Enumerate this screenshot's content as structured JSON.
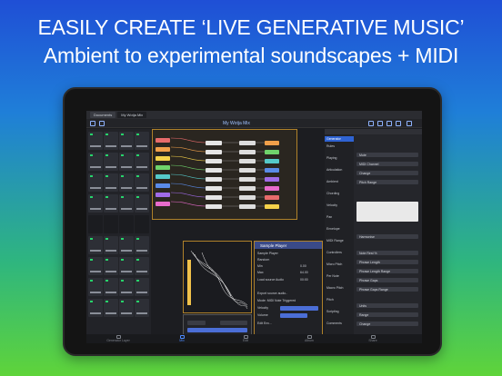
{
  "headline": {
    "line1": "EASILY CREATE ‘LIVE GENERATIVE MUSIC’",
    "line2": "Ambient to experimental soundscapes + MIDI"
  },
  "app": {
    "tabs": [
      "Documents",
      "My Wotja Mix"
    ],
    "title": "My Wotja Mix",
    "bottom_tabs": [
      "Generator Layer",
      "Mix",
      "Edit",
      "Album",
      "Share"
    ],
    "active_tab_index": 1
  },
  "properties_panel": {
    "side_items": [
      "Generator",
      "Rules",
      "Playing",
      "Articulation",
      "Ambient",
      "Chording",
      "Velocity",
      "Pan",
      "Envelope",
      "MIDI Range",
      "Controllers",
      "Micro Pitch",
      "Per Note",
      "Macro Pitch",
      "Pitch",
      "Scripting",
      "Comments"
    ],
    "selected": "Generator",
    "fields": [
      "Mute",
      "MIDI Channel",
      "Change",
      "Pitch Range",
      "Harmonise",
      "Note Rest %",
      "Phrase Length",
      "Phrase Length Range",
      "Phrase Gaps",
      "Phrase Gaps Range",
      "Units",
      "Range",
      "Change"
    ]
  },
  "sample_panel": {
    "title": "Sample Player",
    "rows": [
      "Sample Player",
      "Random",
      "Min",
      "Max",
      "Load source Audio",
      "Export source audio..",
      "Mode: MIDI Note Triggered",
      "Velocity",
      "Volume",
      "Edit Env..."
    ],
    "values": [
      "0.00",
      "64.00",
      "00:00"
    ]
  },
  "colors": {
    "accent": "#2f63d3",
    "orange_border": "#b0822a",
    "led_green": "#27d46b"
  }
}
